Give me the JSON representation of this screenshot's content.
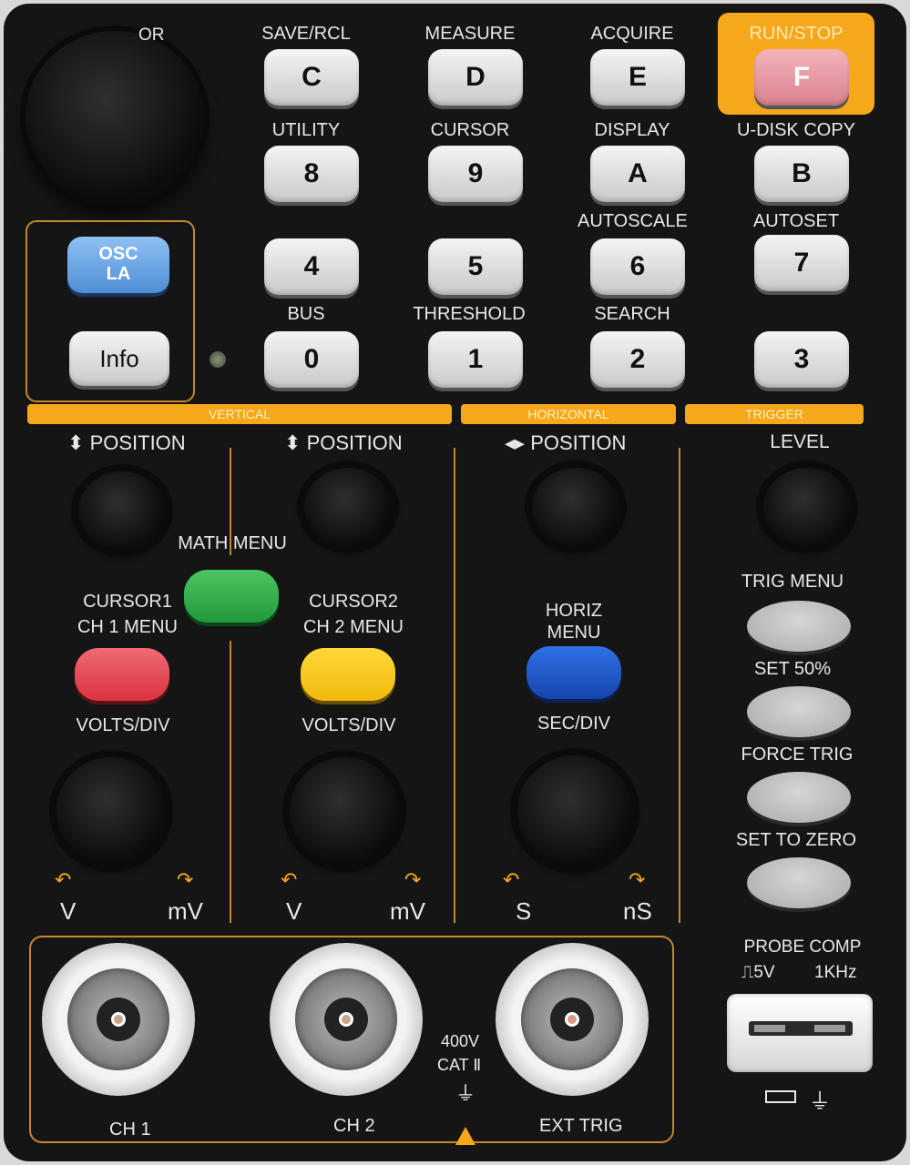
{
  "top": {
    "cursor_label": "OR",
    "run_stop_label": "RUN/STOP",
    "keys": [
      {
        "label": "SAVE/RCL",
        "key": "C"
      },
      {
        "label": "MEASURE",
        "key": "D"
      },
      {
        "label": "ACQUIRE",
        "key": "E"
      },
      {
        "label": "RUN/STOP",
        "key": "F"
      },
      {
        "label": "UTILITY",
        "key": "8"
      },
      {
        "label": "CURSOR",
        "key": "9"
      },
      {
        "label": "DISPLAY",
        "key": "A"
      },
      {
        "label": "U-DISK COPY",
        "key": "B"
      },
      {
        "label": "",
        "key": "4"
      },
      {
        "label": "",
        "key": "5"
      },
      {
        "label": "AUTOSCALE",
        "key": "6"
      },
      {
        "label": "AUTOSET",
        "key": "7"
      },
      {
        "label": "BUS",
        "key": "0"
      },
      {
        "label": "THRESHOLD",
        "key": "1"
      },
      {
        "label": "SEARCH",
        "key": "2"
      },
      {
        "label": "",
        "key": "3"
      }
    ],
    "osc_la_line1": "OSC",
    "osc_la_line2": "LA",
    "info": "Info"
  },
  "bands": {
    "vertical": "VERTICAL",
    "horizontal": "HORIZONTAL",
    "trigger": "TRIGGER"
  },
  "vertical": {
    "ch1_position": "POSITION",
    "ch2_position": "POSITION",
    "math_menu": "MATH MENU",
    "cursor1": "CURSOR1",
    "ch1_menu": "CH 1 MENU",
    "cursor2": "CURSOR2",
    "ch2_menu": "CH 2 MENU",
    "volts_div_1": "VOLTS/DIV",
    "volts_div_2": "VOLTS/DIV",
    "v1": "V",
    "mv1": "mV",
    "v2": "V",
    "mv2": "mV"
  },
  "horizontal": {
    "position": "POSITION",
    "horiz_menu_1": "HORIZ",
    "horiz_menu_2": "MENU",
    "sec_div": "SEC/DIV",
    "s": "S",
    "ns": "nS"
  },
  "trigger": {
    "level": "LEVEL",
    "trig_menu": "TRIG MENU",
    "set_50": "SET 50%",
    "force_trig": "FORCE TRIG",
    "set_to_zero": "SET TO ZERO"
  },
  "inputs": {
    "ch1": "CH 1",
    "ch2": "CH 2",
    "ext_trig": "EXT TRIG",
    "rating_1": "400V",
    "rating_2": "CAT Ⅱ",
    "probe_comp": "PROBE COMP",
    "probe_5v": "5V",
    "probe_1khz": "1KHz"
  },
  "colors": {
    "orange": "#f5a81b",
    "ch1_red": "#e8404d",
    "ch2_yellow": "#f8c514",
    "math_green": "#2fa84a",
    "horiz_blue": "#1d58c8",
    "osc_blue": "#6aa9e8",
    "run_pink": "#e79aa5"
  }
}
